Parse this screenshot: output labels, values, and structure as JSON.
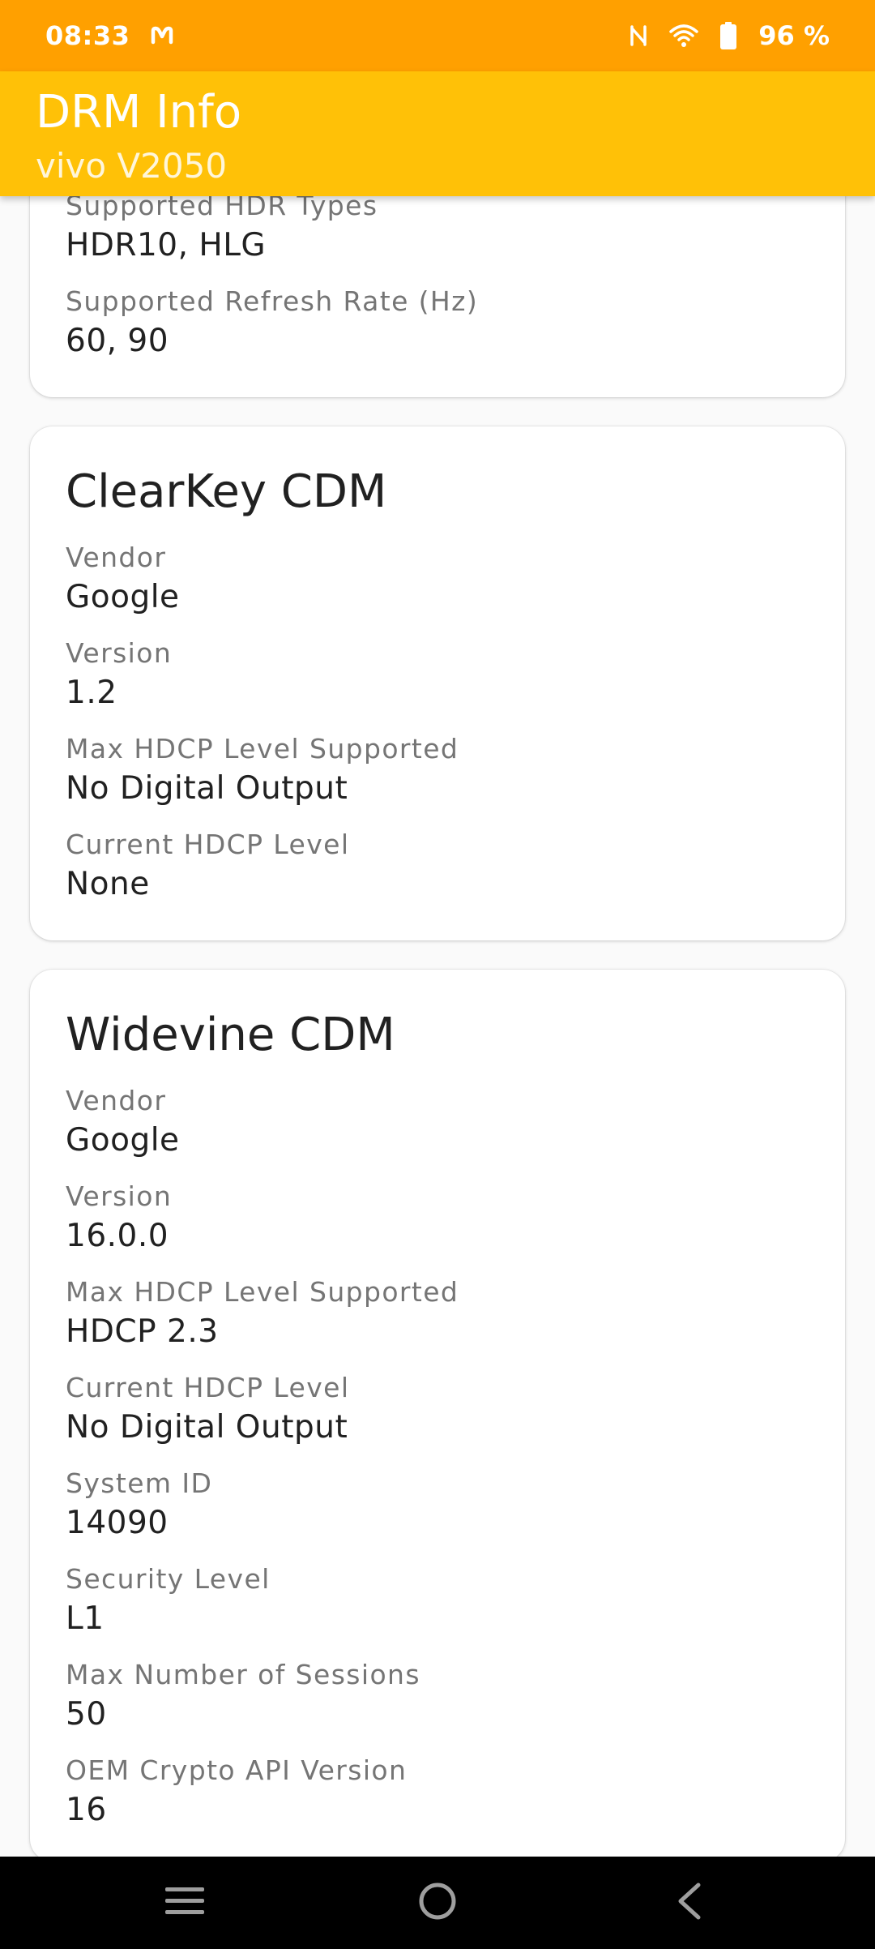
{
  "status_bar": {
    "time": "08:33",
    "battery_percent": "96 %",
    "icons": [
      "notification-m-icon",
      "nfc-icon",
      "wifi-icon",
      "battery-icon"
    ]
  },
  "app_bar": {
    "title": "DRM Info",
    "subtitle": "vivo V2050",
    "color": "#ffc107"
  },
  "display_card": {
    "fields": [
      {
        "label": "Supported HDR Types",
        "value": "HDR10, HLG"
      },
      {
        "label": "Supported Refresh Rate (Hz)",
        "value": "60, 90"
      }
    ]
  },
  "clearkey_card": {
    "title": "ClearKey CDM",
    "fields": [
      {
        "label": "Vendor",
        "value": "Google"
      },
      {
        "label": "Version",
        "value": "1.2"
      },
      {
        "label": "Max HDCP Level Supported",
        "value": "No Digital Output"
      },
      {
        "label": "Current HDCP Level",
        "value": "None"
      }
    ]
  },
  "widevine_card": {
    "title": "Widevine CDM",
    "fields": [
      {
        "label": "Vendor",
        "value": "Google"
      },
      {
        "label": "Version",
        "value": "16.0.0"
      },
      {
        "label": "Max HDCP Level Supported",
        "value": "HDCP 2.3"
      },
      {
        "label": "Current HDCP Level",
        "value": "No Digital Output"
      },
      {
        "label": "System ID",
        "value": "14090"
      },
      {
        "label": "Security Level",
        "value": "L1"
      },
      {
        "label": "Max Number of Sessions",
        "value": "50"
      },
      {
        "label": "OEM Crypto API Version",
        "value": "16"
      }
    ]
  },
  "nav_bar": {
    "buttons": [
      "menu-icon",
      "home-icon",
      "back-icon"
    ]
  }
}
